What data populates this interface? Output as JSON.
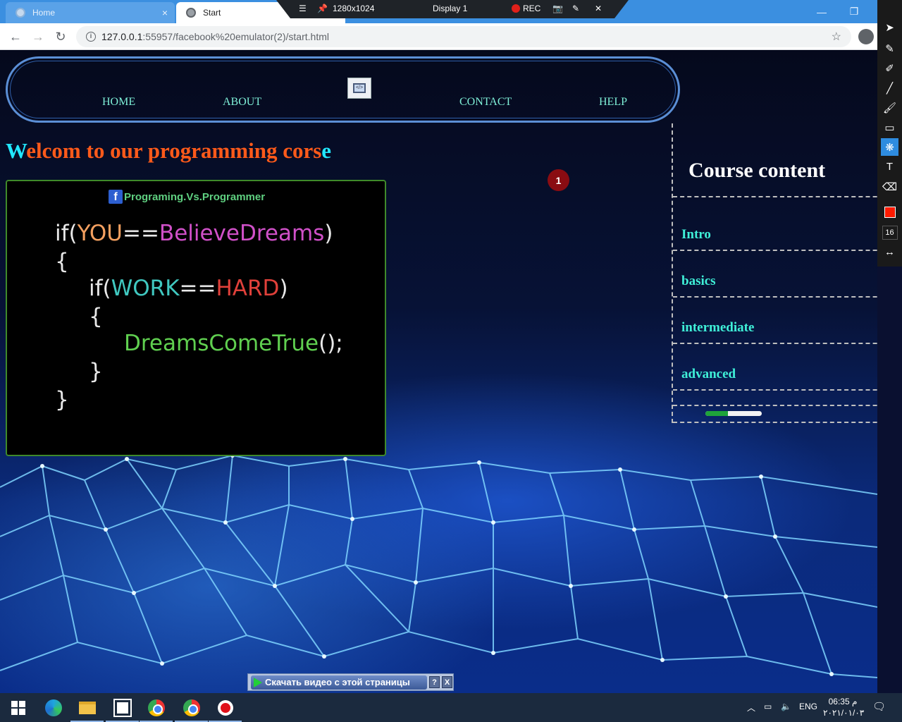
{
  "browser": {
    "tabs": [
      {
        "label": "Home",
        "active": false
      },
      {
        "label": "Start",
        "active": true
      }
    ],
    "tab_close": "×",
    "address": {
      "host": "127.0.0.1",
      "path": ":55957/facebook%20emulator(2)/start.html"
    },
    "window_controls": {
      "minimize": "—",
      "restore": "❐",
      "close": "✕"
    }
  },
  "recorder": {
    "resolution": "1280x1024",
    "display": "Display 1",
    "rec_label": "REC"
  },
  "nav": {
    "items": [
      "HOME",
      "ABOUT",
      "CONTACT",
      "HELP"
    ],
    "logo_glyph": "</>"
  },
  "welcome": {
    "first": "W",
    "middle": "elcom to our programming cors",
    "last": "e"
  },
  "code_image": {
    "fb_letter": "f",
    "caption": "Programing.Vs.Programmer",
    "lines": {
      "l1": {
        "a": "if(",
        "b": "YOU",
        "c": "==",
        "d": "BelieveDreams",
        "e": ")"
      },
      "l2": "{",
      "l3": {
        "a": "if(",
        "b": "WORK",
        "c": "==",
        "d": "HARD",
        "e": ")"
      },
      "l4": "{",
      "l5": {
        "a": "DreamsComeTrue",
        "b": "();"
      },
      "l6": "}",
      "l7": "}"
    }
  },
  "notification_badge": "1",
  "sidebar": {
    "title": "Course content",
    "items": [
      "Intro",
      "basics",
      "intermediate",
      "advanced"
    ],
    "progress_value": 0.4
  },
  "download_bar": {
    "label": "Скачать видео с этой страницы",
    "help": "?",
    "close": "X"
  },
  "annotation_tools": [
    "cursor-icon",
    "pen-icon",
    "marker-icon",
    "line-icon",
    "brush-icon",
    "rectangle-icon",
    "effects-icon",
    "text-icon",
    "eraser-icon"
  ],
  "annotation_color": "#ff1a00",
  "annotation_size": "16",
  "annotation_text_tool": "T",
  "taskbar": {
    "language": "ENG",
    "time": "06:35 م",
    "date": "٢٠٢١/٠١/٠٣"
  }
}
